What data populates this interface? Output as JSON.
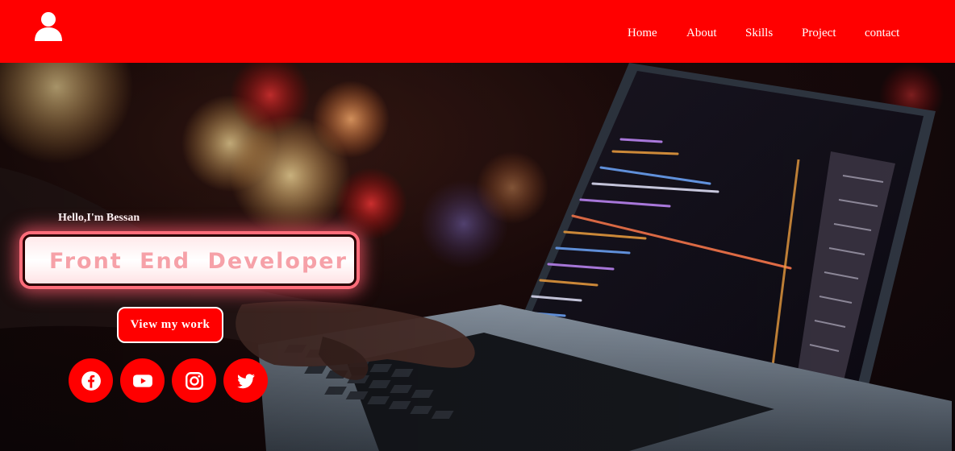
{
  "header": {
    "logo_icon": "user-icon",
    "brand_color": "#ff0000",
    "nav": [
      {
        "label": "Home"
      },
      {
        "label": "About"
      },
      {
        "label": "Skills"
      },
      {
        "label": "Project"
      },
      {
        "label": "contact"
      }
    ]
  },
  "hero": {
    "background": "laptop-code-photo",
    "greeting": "Hello,I'm Bessan",
    "role": "Front End Developer",
    "cta_label": "View my work",
    "social": [
      {
        "icon": "facebook-icon"
      },
      {
        "icon": "youtube-icon"
      },
      {
        "icon": "instagram-icon"
      },
      {
        "icon": "twitter-icon"
      }
    ]
  }
}
